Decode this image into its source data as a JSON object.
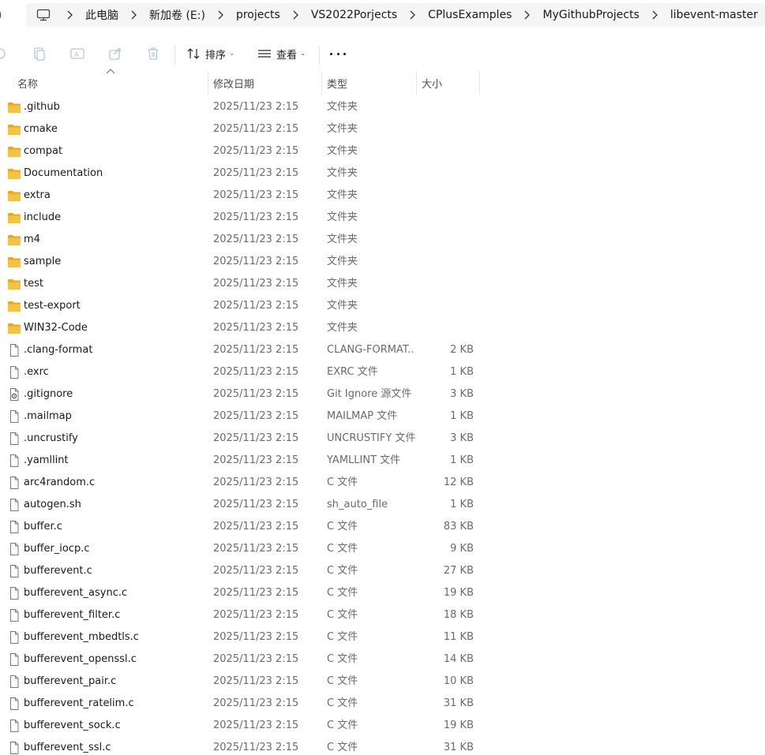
{
  "address_bar": {
    "breadcrumbs": [
      "此电脑",
      "新加卷 (E:)",
      "projects",
      "VS2022Porjects",
      "CPlusExamples",
      "MyGithubProjects",
      "libevent-master"
    ]
  },
  "toolbar": {
    "sort_label": "排序",
    "view_label": "查看"
  },
  "columns": {
    "name": "名称",
    "date": "修改日期",
    "type": "类型",
    "size": "大小"
  },
  "files": [
    {
      "name": ".github",
      "date": "2025/11/23 2:15",
      "type": "文件夹",
      "size": "",
      "icon": "folder-icon"
    },
    {
      "name": "cmake",
      "date": "2025/11/23 2:15",
      "type": "文件夹",
      "size": "",
      "icon": "folder-icon"
    },
    {
      "name": "compat",
      "date": "2025/11/23 2:15",
      "type": "文件夹",
      "size": "",
      "icon": "folder-icon"
    },
    {
      "name": "Documentation",
      "date": "2025/11/23 2:15",
      "type": "文件夹",
      "size": "",
      "icon": "folder-icon"
    },
    {
      "name": "extra",
      "date": "2025/11/23 2:15",
      "type": "文件夹",
      "size": "",
      "icon": "folder-icon"
    },
    {
      "name": "include",
      "date": "2025/11/23 2:15",
      "type": "文件夹",
      "size": "",
      "icon": "folder-icon"
    },
    {
      "name": "m4",
      "date": "2025/11/23 2:15",
      "type": "文件夹",
      "size": "",
      "icon": "folder-icon"
    },
    {
      "name": "sample",
      "date": "2025/11/23 2:15",
      "type": "文件夹",
      "size": "",
      "icon": "folder-icon"
    },
    {
      "name": "test",
      "date": "2025/11/23 2:15",
      "type": "文件夹",
      "size": "",
      "icon": "folder-icon"
    },
    {
      "name": "test-export",
      "date": "2025/11/23 2:15",
      "type": "文件夹",
      "size": "",
      "icon": "folder-icon"
    },
    {
      "name": "WIN32-Code",
      "date": "2025/11/23 2:15",
      "type": "文件夹",
      "size": "",
      "icon": "folder-icon"
    },
    {
      "name": ".clang-format",
      "date": "2025/11/23 2:15",
      "type": "CLANG-FORMAT...",
      "size": "2 KB",
      "icon": "file-icon"
    },
    {
      "name": ".exrc",
      "date": "2025/11/23 2:15",
      "type": "EXRC 文件",
      "size": "1 KB",
      "icon": "file-icon"
    },
    {
      "name": ".gitignore",
      "date": "2025/11/23 2:15",
      "type": "Git Ignore 源文件",
      "size": "3 KB",
      "icon": "git-file-icon"
    },
    {
      "name": ".mailmap",
      "date": "2025/11/23 2:15",
      "type": "MAILMAP 文件",
      "size": "1 KB",
      "icon": "file-icon"
    },
    {
      "name": ".uncrustify",
      "date": "2025/11/23 2:15",
      "type": "UNCRUSTIFY 文件",
      "size": "3 KB",
      "icon": "file-icon"
    },
    {
      "name": ".yamllint",
      "date": "2025/11/23 2:15",
      "type": "YAMLLINT 文件",
      "size": "1 KB",
      "icon": "file-icon"
    },
    {
      "name": "arc4random.c",
      "date": "2025/11/23 2:15",
      "type": "C 文件",
      "size": "12 KB",
      "icon": "file-icon"
    },
    {
      "name": "autogen.sh",
      "date": "2025/11/23 2:15",
      "type": "sh_auto_file",
      "size": "1 KB",
      "icon": "file-icon"
    },
    {
      "name": "buffer.c",
      "date": "2025/11/23 2:15",
      "type": "C 文件",
      "size": "83 KB",
      "icon": "file-icon"
    },
    {
      "name": "buffer_iocp.c",
      "date": "2025/11/23 2:15",
      "type": "C 文件",
      "size": "9 KB",
      "icon": "file-icon"
    },
    {
      "name": "bufferevent.c",
      "date": "2025/11/23 2:15",
      "type": "C 文件",
      "size": "27 KB",
      "icon": "file-icon"
    },
    {
      "name": "bufferevent_async.c",
      "date": "2025/11/23 2:15",
      "type": "C 文件",
      "size": "19 KB",
      "icon": "file-icon"
    },
    {
      "name": "bufferevent_filter.c",
      "date": "2025/11/23 2:15",
      "type": "C 文件",
      "size": "18 KB",
      "icon": "file-icon"
    },
    {
      "name": "bufferevent_mbedtls.c",
      "date": "2025/11/23 2:15",
      "type": "C 文件",
      "size": "11 KB",
      "icon": "file-icon"
    },
    {
      "name": "bufferevent_openssl.c",
      "date": "2025/11/23 2:15",
      "type": "C 文件",
      "size": "14 KB",
      "icon": "file-icon"
    },
    {
      "name": "bufferevent_pair.c",
      "date": "2025/11/23 2:15",
      "type": "C 文件",
      "size": "10 KB",
      "icon": "file-icon"
    },
    {
      "name": "bufferevent_ratelim.c",
      "date": "2025/11/23 2:15",
      "type": "C 文件",
      "size": "31 KB",
      "icon": "file-icon"
    },
    {
      "name": "bufferevent_sock.c",
      "date": "2025/11/23 2:15",
      "type": "C 文件",
      "size": "19 KB",
      "icon": "file-icon"
    },
    {
      "name": "bufferevent_ssl.c",
      "date": "2025/11/23 2:15",
      "type": "C 文件",
      "size": "31 KB",
      "icon": "file-icon"
    }
  ],
  "colors": {
    "folder": "#f5c242",
    "folder_dark": "#e3a82b",
    "address_bg": "#f5f5f5",
    "muted_text": "#6b6b6b"
  }
}
